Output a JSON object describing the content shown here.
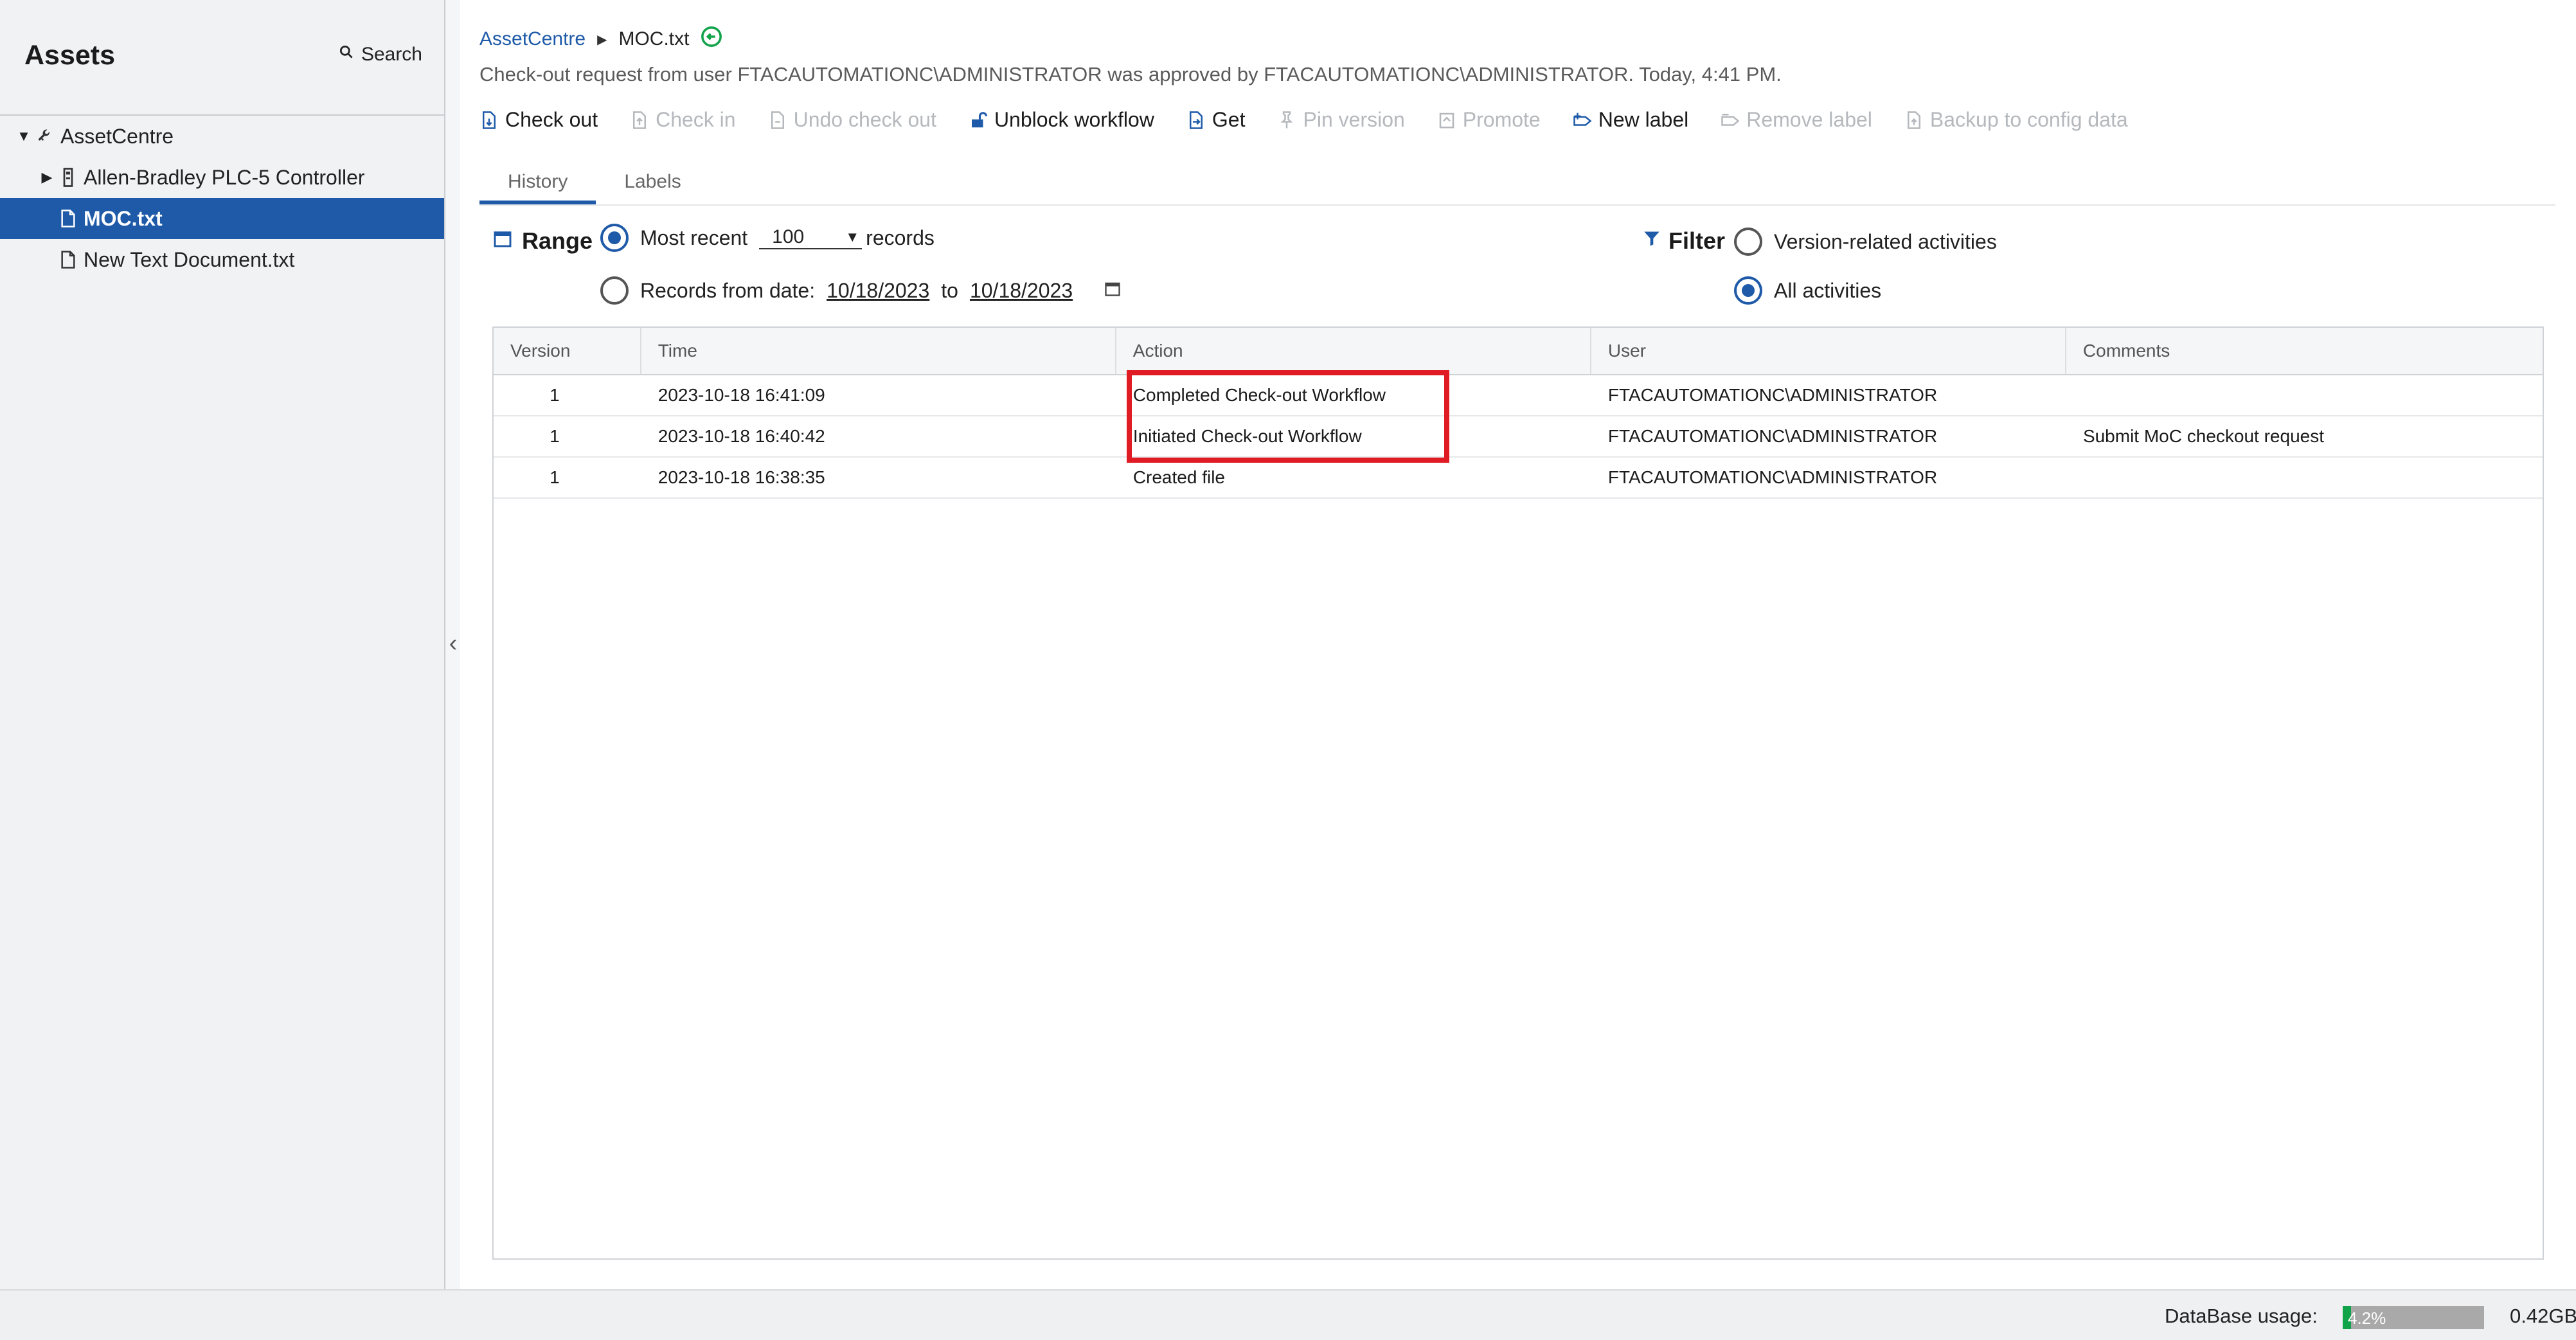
{
  "sidebar": {
    "title": "Assets",
    "search_label": "Search",
    "tree": [
      {
        "label": "AssetCentre",
        "level": 0,
        "expanded": true,
        "selected": false
      },
      {
        "label": "Allen-Bradley PLC-5 Controller",
        "level": 1,
        "expanded": false,
        "selected": false
      },
      {
        "label": "MOC.txt",
        "level": 1,
        "selected": true
      },
      {
        "label": "New Text Document.txt",
        "level": 1,
        "selected": false
      }
    ]
  },
  "breadcrumb": {
    "root": "AssetCentre",
    "current": "MOC.txt"
  },
  "status_message": "Check-out request from user FTACAUTOMATIONC\\ADMINISTRATOR was approved by FTACAUTOMATIONC\\ADMINISTRATOR. Today, 4:41 PM.",
  "toolbar": {
    "check_out": "Check out",
    "check_in": "Check in",
    "undo_check_out": "Undo check out",
    "unblock_workflow": "Unblock workflow",
    "get": "Get",
    "pin_version": "Pin version",
    "promote": "Promote",
    "new_label": "New label",
    "remove_label": "Remove label",
    "backup": "Backup to config data"
  },
  "tabs": {
    "history": "History",
    "labels": "Labels",
    "active": "History"
  },
  "range": {
    "title": "Range",
    "most_recent_label": "Most recent",
    "most_recent_value": "100",
    "records_suffix": "records",
    "from_date_label": "Records from date:",
    "from_date": "10/18/2023",
    "to_word": "to",
    "to_date": "10/18/2023",
    "selected": "most_recent"
  },
  "filter": {
    "title": "Filter",
    "option_version": "Version-related activities",
    "option_all": "All activities",
    "selected": "all"
  },
  "table": {
    "headers": [
      "Version",
      "Time",
      "Action",
      "User",
      "Comments"
    ],
    "rows": [
      {
        "version": "1",
        "time": "2023-10-18 16:41:09",
        "action": "Completed Check-out Workflow",
        "user": "FTACAUTOMATIONC\\ADMINISTRATOR",
        "comments": ""
      },
      {
        "version": "1",
        "time": "2023-10-18 16:40:42",
        "action": "Initiated Check-out Workflow",
        "user": "FTACAUTOMATIONC\\ADMINISTRATOR",
        "comments": "Submit MoC checkout request"
      },
      {
        "version": "1",
        "time": "2023-10-18 16:38:35",
        "action": "Created file",
        "user": "FTACAUTOMATIONC\\ADMINISTRATOR",
        "comments": ""
      }
    ]
  },
  "footer": {
    "db_label": "DataBase usage:",
    "db_percent_text": "4.2%",
    "db_percent_value": 4.2,
    "db_size": "0.42GB"
  },
  "colors": {
    "accent": "#1e5aa8",
    "highlight": "#e11b24",
    "progress": "#11a34a"
  }
}
